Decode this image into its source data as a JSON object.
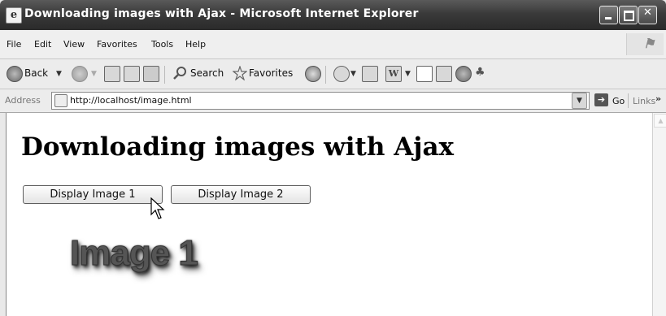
{
  "window": {
    "title": "Downloading images with Ajax - Microsoft Internet Explorer",
    "controls": [
      "minimize",
      "maximize",
      "close"
    ]
  },
  "menubar": {
    "items": [
      "File",
      "Edit",
      "View",
      "Favorites",
      "Tools",
      "Help"
    ]
  },
  "toolbar": {
    "back_label": "Back",
    "search_label": "Search",
    "favorites_label": "Favorites",
    "icons": [
      "back-icon",
      "forward-icon",
      "stop-icon",
      "refresh-icon",
      "home-icon",
      "search-icon",
      "favorites-star-icon",
      "history-icon",
      "mail-icon",
      "print-icon",
      "word-icon",
      "discuss-icon",
      "research-icon",
      "messenger-icon",
      "ie-plugin-icon"
    ]
  },
  "addressbar": {
    "label": "Address",
    "url": "http://localhost/image.html",
    "go_label": "Go",
    "links_label": "Links"
  },
  "page": {
    "heading": "Downloading images with Ajax",
    "button1_label": "Display Image 1",
    "button2_label": "Display Image 2",
    "image_text": "Image 1"
  },
  "colors": {
    "titlebar": "#3a3a3a",
    "chrome": "#ececec",
    "content_bg": "#ffffff"
  }
}
